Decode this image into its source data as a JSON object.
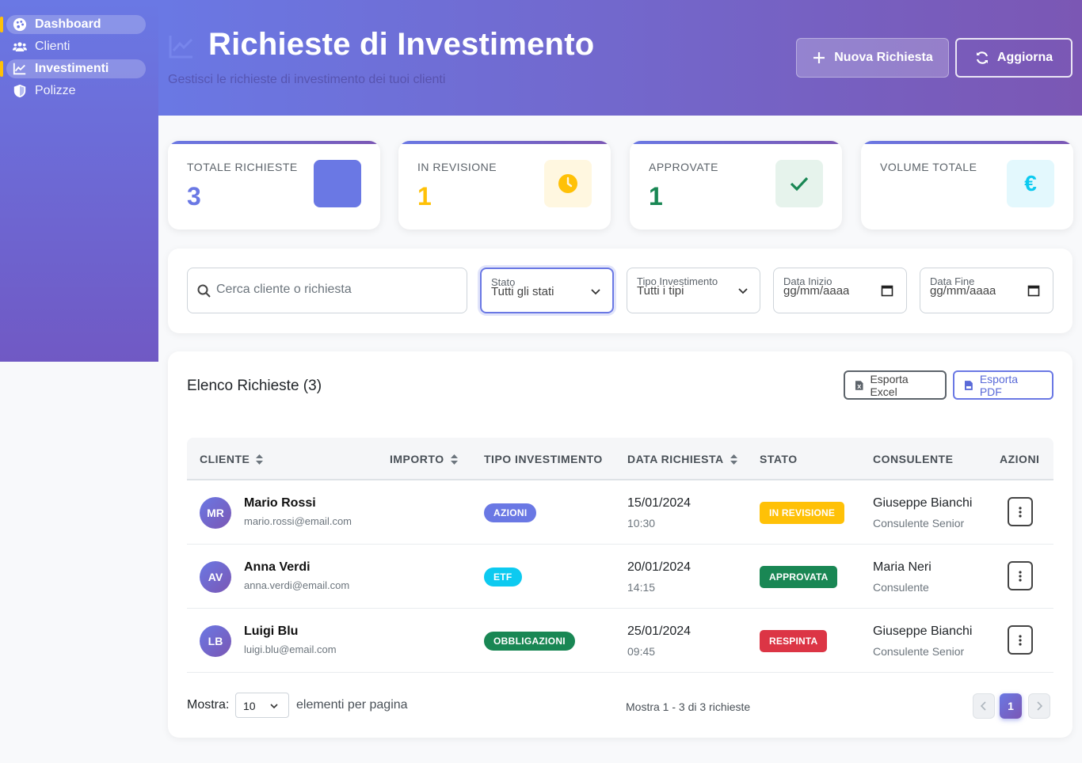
{
  "sidebar": {
    "items": [
      {
        "label": "Dashboard",
        "icon": "palette-icon",
        "active": true
      },
      {
        "label": "Clienti",
        "icon": "users-icon",
        "active": false
      },
      {
        "label": "Investimenti",
        "icon": "chart-line-icon",
        "active": true
      },
      {
        "label": "Polizze",
        "icon": "shield-icon",
        "active": false
      }
    ]
  },
  "header": {
    "title": "Richieste di Investimento",
    "subtitle": "Gestisci le richieste di investimento dei tuoi clienti",
    "new_button": "Nuova Richiesta",
    "refresh_button": "Aggiorna"
  },
  "stats": [
    {
      "label": "TOTALE RICHIESTE",
      "value": "3",
      "color": "#6a78e4",
      "icon": "square-icon",
      "icon_bg": "#6a78e4"
    },
    {
      "label": "IN REVISIONE",
      "value": "1",
      "color": "#ffc107",
      "icon": "clock-icon",
      "icon_bg": "#fff7e0"
    },
    {
      "label": "APPROVATE",
      "value": "1",
      "color": "#198754",
      "icon": "check-icon",
      "icon_bg": "#e6f3ec"
    },
    {
      "label": "VOLUME TOTALE",
      "value": "",
      "color": "#0dcaf0",
      "icon": "euro-icon",
      "icon_bg": "#e3f8fd"
    }
  ],
  "filters": {
    "search_placeholder": "Cerca cliente o richiesta",
    "stato": {
      "label": "Stato",
      "value": "Tutti gli stati"
    },
    "tipo": {
      "label": "Tipo Investimento",
      "value": "Tutti i tipi"
    },
    "data_inizio": {
      "label": "Data Inizio",
      "value": "gg/mm/aaaa"
    },
    "data_fine": {
      "label": "Data Fine",
      "value": "gg/mm/aaaa"
    }
  },
  "table": {
    "title": "Elenco Richieste (3)",
    "export_excel": "Esporta Excel",
    "export_pdf": "Esporta PDF",
    "columns": [
      "CLIENTE",
      "IMPORTO",
      "TIPO INVESTIMENTO",
      "DATA RICHIESTA",
      "STATO",
      "CONSULENTE",
      "AZIONI"
    ],
    "rows": [
      {
        "initials": "MR",
        "name": "Mario Rossi",
        "email": "mario.rossi@email.com",
        "importo": "",
        "tipo": "AZIONI",
        "tipo_color": "#6a78e4",
        "date": "15/01/2024",
        "time": "10:30",
        "status": "IN REVISIONE",
        "status_bg": "#ffc107",
        "status_fg": "#ffffff",
        "consulente": "Giuseppe Bianchi",
        "role": "Consulente Senior"
      },
      {
        "initials": "AV",
        "name": "Anna Verdi",
        "email": "anna.verdi@email.com",
        "importo": "",
        "tipo": "ETF",
        "tipo_color": "#0dcaf0",
        "date": "20/01/2024",
        "time": "14:15",
        "status": "APPROVATA",
        "status_bg": "#198754",
        "status_fg": "#ffffff",
        "consulente": "Maria Neri",
        "role": "Consulente"
      },
      {
        "initials": "LB",
        "name": "Luigi Blu",
        "email": "luigi.blu@email.com",
        "importo": "",
        "tipo": "OBBLIGAZIONI",
        "tipo_color": "#198754",
        "date": "25/01/2024",
        "time": "09:45",
        "status": "RESPINTA",
        "status_bg": "#dc3545",
        "status_fg": "#ffffff",
        "consulente": "Giuseppe Bianchi",
        "role": "Consulente Senior"
      }
    ]
  },
  "pagination": {
    "show_label": "Mostra:",
    "page_size": "10",
    "per_page_label": "elementi per pagina",
    "info": "Mostra 1 - 3 di 3 richieste",
    "current_page": "1"
  }
}
